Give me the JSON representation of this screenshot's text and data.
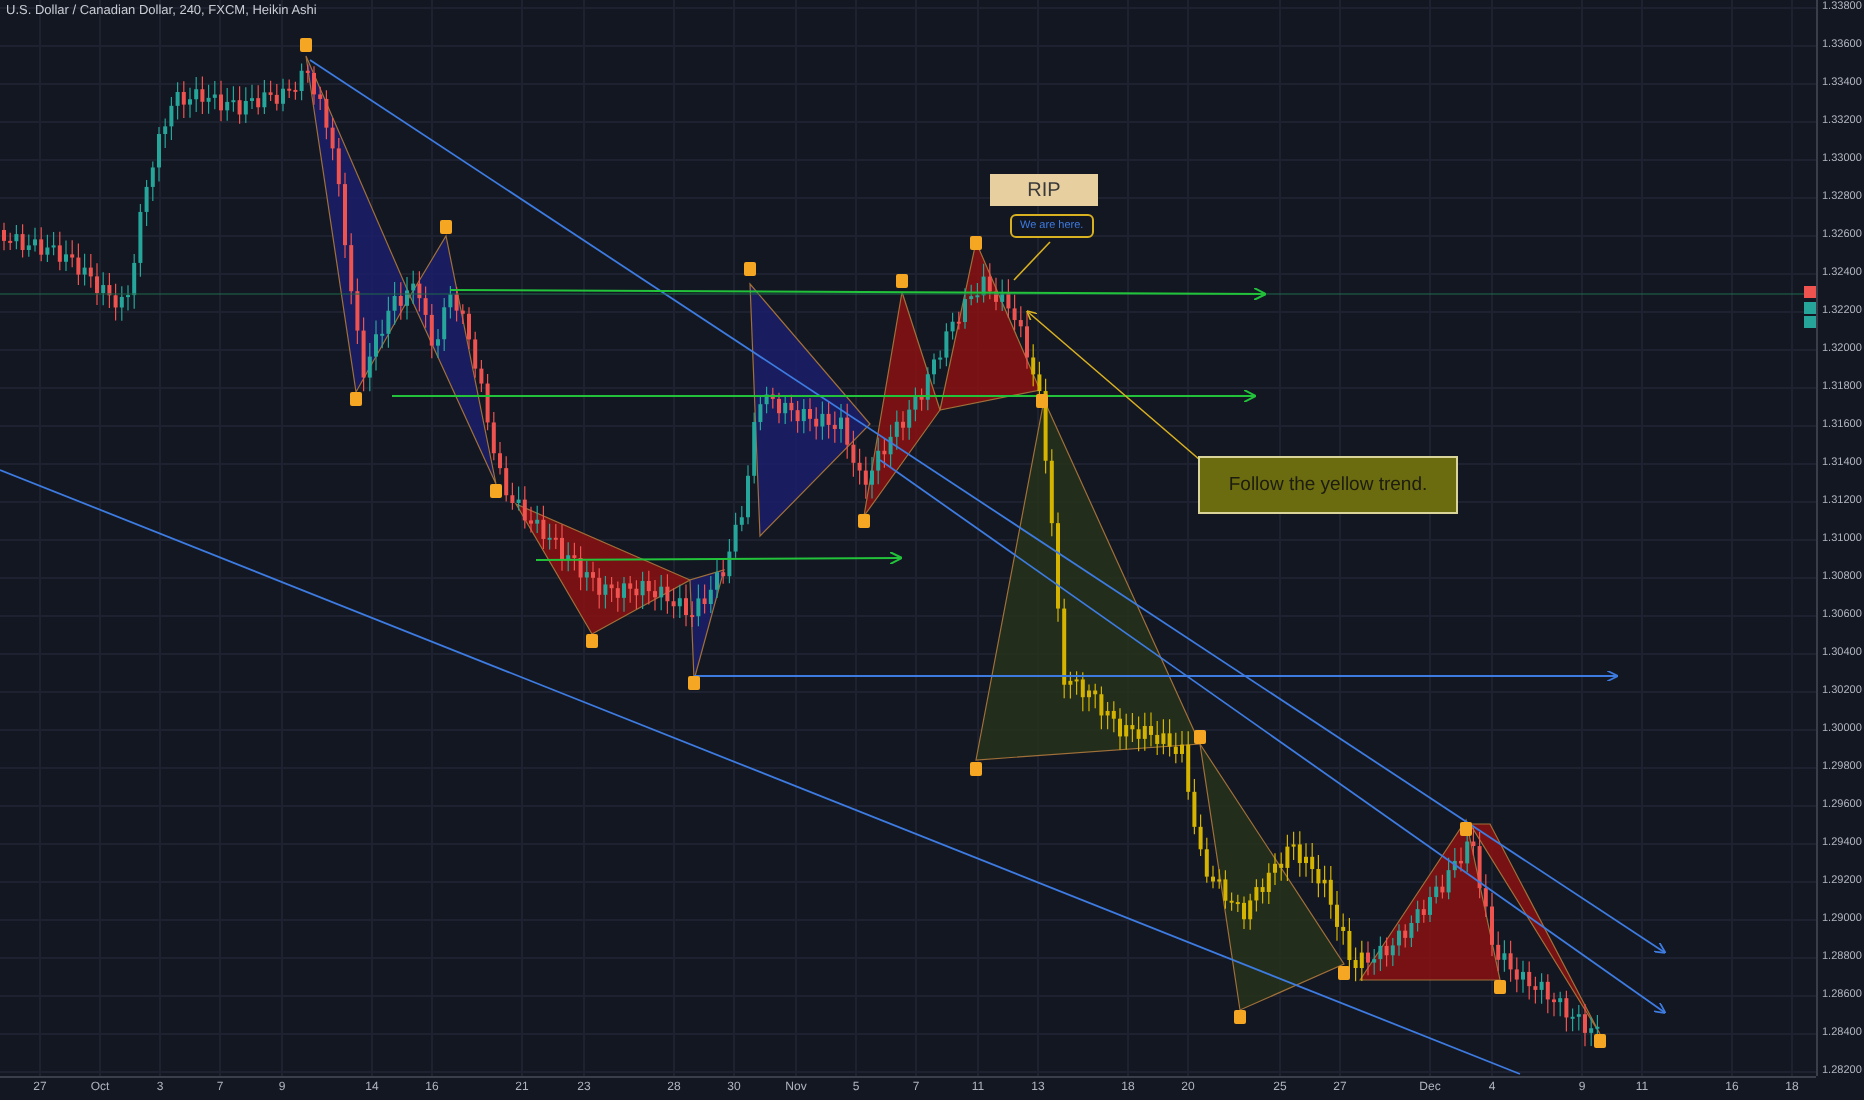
{
  "header": {
    "title": "U.S. Dollar / Canadian Dollar, 240, FXCM, Heikin Ashi"
  },
  "annotations": {
    "rip": "RIP",
    "we_are_here": "We are here.",
    "follow": "Follow the yellow trend."
  },
  "price_axis": [
    "1.33800",
    "1.33600",
    "1.33400",
    "1.33200",
    "1.33000",
    "1.32800",
    "1.32600",
    "1.32400",
    "1.32200",
    "1.32000",
    "1.31800",
    "1.31600",
    "1.31400",
    "1.31200",
    "1.31000",
    "1.30800",
    "1.30600",
    "1.30400",
    "1.30200",
    "1.30000",
    "1.29800",
    "1.29600",
    "1.29400",
    "1.29200",
    "1.29000",
    "1.28800",
    "1.28600",
    "1.28400",
    "1.28200"
  ],
  "time_axis": [
    "27",
    "Oct",
    "3",
    "7",
    "9",
    "14",
    "16",
    "21",
    "23",
    "28",
    "30",
    "Nov",
    "5",
    "7",
    "11",
    "13",
    "18",
    "20",
    "25",
    "27",
    "Dec",
    "4",
    "9",
    "11",
    "16",
    "18"
  ]
}
